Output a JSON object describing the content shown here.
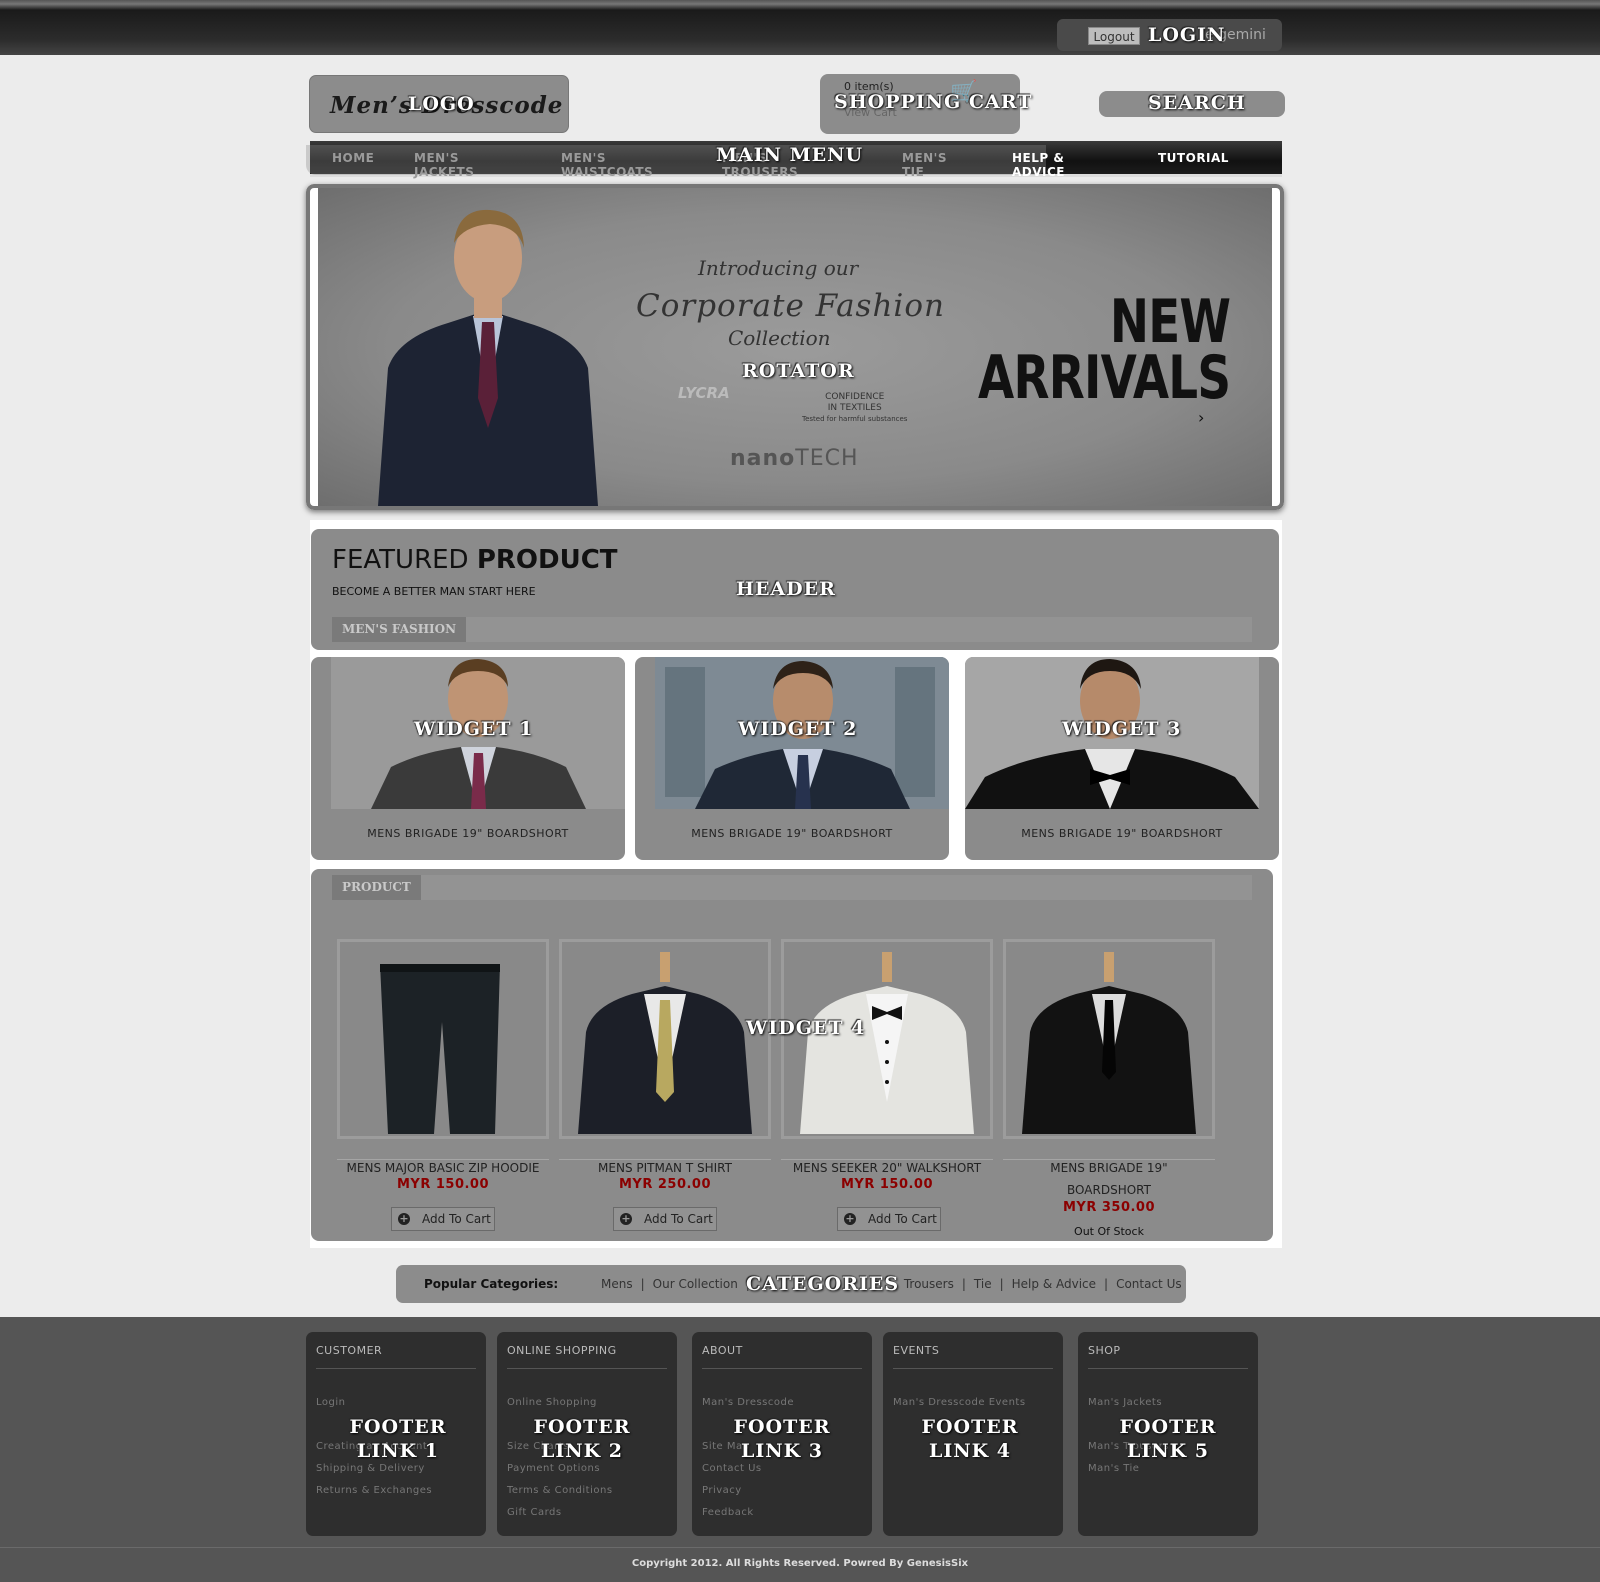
{
  "labels": {
    "login": "LOGIN",
    "logo": "LOGO",
    "shopping_cart": "SHOPPING CART",
    "search": "SEARCH",
    "main_menu": "MAIN MENU",
    "rotator": "ROTATOR",
    "header": "HEADER",
    "widget1": "WIDGET 1",
    "widget2": "WIDGET 2",
    "widget3": "WIDGET 3",
    "widget4": "WIDGET 4",
    "categories": "CATEGORIES",
    "footer1": "FOOTER LINK 1",
    "footer2": "FOOTER LINK 2",
    "footer3": "FOOTER LINK 3",
    "footer4": "FOOTER LINK 4",
    "footer5": "FOOTER LINK 5"
  },
  "topbar": {
    "logout_label": "Logout",
    "welcome": "e gemini"
  },
  "logo": {
    "text": "Men’s Dresscode"
  },
  "cart": {
    "items": "0 item(s)",
    "view": "View Cart"
  },
  "menu": {
    "items": [
      "HOME",
      "MEN'S JACKETS",
      "MEN'S WAISTCOATS",
      "MEN'S TROUSERS",
      "MEN'S TIE",
      "HELP & ADVICE",
      "TUTORIAL"
    ]
  },
  "rotator": {
    "line1": "Introducing our",
    "line2": "Corporate Fashion",
    "line3": "Collection",
    "new": "NEW",
    "arrivals": "ARRIVALS",
    "lycra": "LYCRA",
    "confidence1": "CONFIDENCE",
    "confidence2": "IN TEXTILES",
    "confidence3": "Tested for harmful substances",
    "nano1": "nano",
    "nano2": "TECH",
    "next_arrow": "›"
  },
  "featured": {
    "title_light": "FEATURED ",
    "title_bold": "PRODUCT",
    "subtitle": "BECOME A BETTER MAN START HERE",
    "tab": "MEN'S FASHION"
  },
  "widgets": [
    {
      "label": "MENS BRIGADE 19\" BOARDSHORT"
    },
    {
      "label": "MENS BRIGADE 19\" BOARDSHORT"
    },
    {
      "label": "MENS BRIGADE 19\" BOARDSHORT"
    }
  ],
  "product": {
    "tab": "PRODUCT",
    "add_to_cart": "Add To Cart",
    "items": [
      {
        "name": "MENS MAJOR BASIC ZIP HOODIE",
        "price": "MYR 150.00"
      },
      {
        "name": "MENS PITMAN T SHIRT",
        "price": "MYR 250.00"
      },
      {
        "name": "MENS SEEKER 20\" WALKSHORT",
        "price": "MYR 150.00"
      },
      {
        "name_line1": "MENS BRIGADE 19\"",
        "name_line2": "BOARDSHORT",
        "price": "MYR 350.00",
        "stock": "Out Of Stock"
      }
    ]
  },
  "categories": {
    "label": "Popular Categories:",
    "links": [
      "Mens",
      "Our Collection",
      "Trousers",
      "Tie",
      "Help & Advice",
      "Contact Us"
    ]
  },
  "footer": {
    "columns": [
      {
        "title": "CUSTOMER",
        "links": [
          "Login",
          "Creating an Account",
          "Shipping & Delivery",
          "Returns & Exchanges"
        ]
      },
      {
        "title": "ONLINE SHOPPING",
        "links": [
          "Online Shopping",
          "Size Charts",
          "Payment Options",
          "Terms & Conditions",
          "Gift Cards"
        ]
      },
      {
        "title": "ABOUT",
        "links": [
          "Man's Dresscode",
          "Site Map",
          "Contact Us",
          "Privacy",
          "Feedback"
        ]
      },
      {
        "title": "EVENTS",
        "links": [
          "Man's Dresscode Events"
        ]
      },
      {
        "title": "SHOP",
        "links": [
          "Man's Jackets",
          "Man's Trousers",
          "Man's Tie"
        ]
      }
    ],
    "copyright": "Copyright 2012. All Rights Reserved. Powred By GenesisSix"
  },
  "colors": {
    "price": "#8b0000",
    "panel": "#8b8b8b",
    "footer_bg": "#555555",
    "footer_col": "#2e2e2e"
  }
}
